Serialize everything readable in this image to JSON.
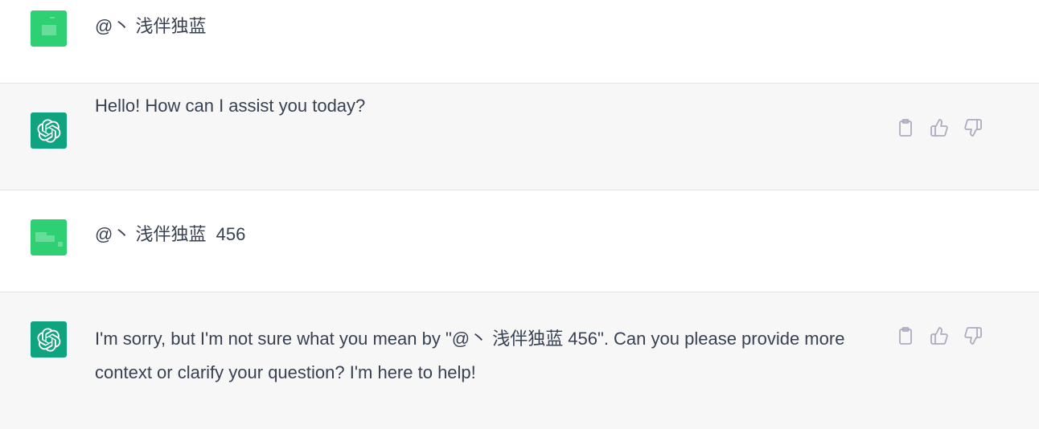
{
  "messages": [
    {
      "role": "user",
      "text": "@丶 浅伴独蓝",
      "avatar_icon": "user-avatar-icon"
    },
    {
      "role": "assistant",
      "text": "Hello! How can I assist you today?",
      "avatar_icon": "openai-logo-icon"
    },
    {
      "role": "user",
      "text": "@丶 浅伴独蓝  456",
      "avatar_icon": "user-avatar-icon"
    },
    {
      "role": "assistant",
      "text": "I'm sorry, but I'm not sure what you mean by \"@丶 浅伴独蓝 456\". Can you please provide more context or clarify your question? I'm here to help!",
      "avatar_icon": "openai-logo-icon"
    }
  ],
  "actions": {
    "copy_icon": "clipboard-icon",
    "like_icon": "thumbs-up-icon",
    "dislike_icon": "thumbs-down-icon"
  },
  "colors": {
    "user_avatar": "#2fcf73",
    "assistant_avatar": "#10a37f",
    "assistant_bg": "#f7f7f8",
    "text": "#374151",
    "icon": "#acacbe"
  }
}
